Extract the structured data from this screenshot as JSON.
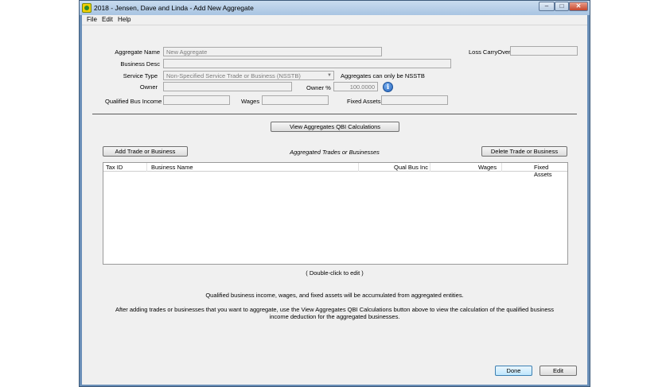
{
  "window": {
    "title": "2018 - Jensen, Dave and Linda - Add New Aggregate",
    "minimize": "–",
    "maximize": "□",
    "close": "✕"
  },
  "menu": [
    "File",
    "Edit",
    "Help"
  ],
  "form": {
    "aggregate_name_label": "Aggregate Name",
    "aggregate_name_value": "New Aggregate",
    "business_desc_label": "Business Desc",
    "business_desc_value": "",
    "service_type_label": "Service Type",
    "service_type_value": "Non-Specified Service Trade or Business (NSSTB)",
    "nsstb_note": "Aggregates can only be NSSTB",
    "owner_label": "Owner",
    "owner_value": "",
    "owner_pct_label": "Owner %",
    "owner_pct_value": "100.0000",
    "qbi_label": "Qualified Bus Income",
    "qbi_value": "",
    "wages_label": "Wages",
    "wages_value": "",
    "fixed_assets_label": "Fixed Assets",
    "fixed_assets_value": "",
    "loss_carryover_label": "Loss CarryOver",
    "loss_carryover_value": ""
  },
  "buttons": {
    "view_qbi": "View Aggregates QBI Calculations",
    "add_trade": "Add Trade or Business",
    "delete_trade": "Delete Trade or Business",
    "done": "Done",
    "edit": "Edit"
  },
  "section_title": "Aggregated Trades or Businesses",
  "grid": {
    "columns": [
      "Tax ID",
      "Business Name",
      "Qual Bus Inc",
      "Wages",
      "Fixed Assets"
    ],
    "rows": []
  },
  "hint": "( Double-click to edit )",
  "notes": {
    "line1": "Qualified business income, wages, and fixed assets will be accumulated from aggregated entities.",
    "line2": "After adding trades or businesses that you want to aggregate, use the View Aggregates QBI Calculations button above to view the calculation of the qualified business income deduction for the aggregated businesses."
  },
  "icons": {
    "app": "app-logo-icon",
    "info": "info-icon",
    "dropdown": "chevron-down-icon"
  }
}
